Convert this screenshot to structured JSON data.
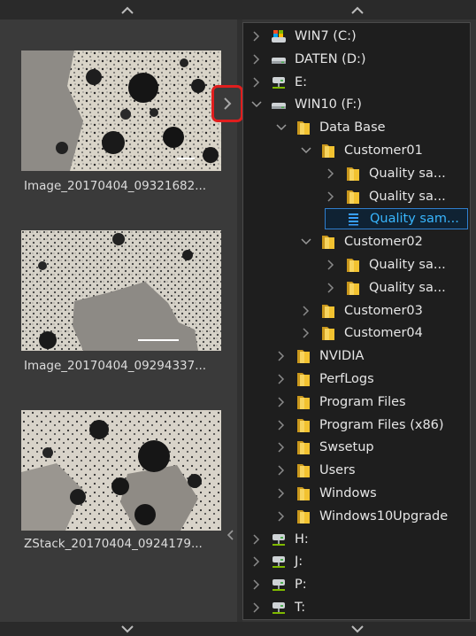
{
  "thumbnails": [
    {
      "name": "Image_20170404_09321682..."
    },
    {
      "name": "Image_20170404_09294337..."
    },
    {
      "name": "ZStack_20170404_0924179..."
    }
  ],
  "tree": {
    "items": [
      {
        "label": "WIN7 (C:)",
        "level": 0,
        "icon": "drive-windows-icon",
        "state": "collapsed"
      },
      {
        "label": "DATEN (D:)",
        "level": 0,
        "icon": "drive-icon",
        "state": "collapsed"
      },
      {
        "label": "E:",
        "level": 0,
        "icon": "drive-network-icon",
        "state": "collapsed"
      },
      {
        "label": "WIN10 (F:)",
        "level": 0,
        "icon": "drive-icon",
        "state": "expanded"
      },
      {
        "label": "Data Base",
        "level": 1,
        "icon": "folder-icon",
        "state": "expanded"
      },
      {
        "label": "Customer01",
        "level": 2,
        "icon": "folder-icon",
        "state": "expanded"
      },
      {
        "label": "Quality sa...",
        "level": 3,
        "icon": "folder-icon",
        "state": "collapsed"
      },
      {
        "label": "Quality sa...",
        "level": 3,
        "icon": "folder-icon",
        "state": "collapsed"
      },
      {
        "label": "Quality sam...",
        "level": 3,
        "icon": "database-file-icon",
        "state": "leaf",
        "selected": true
      },
      {
        "label": "Customer02",
        "level": 2,
        "icon": "folder-icon",
        "state": "expanded"
      },
      {
        "label": "Quality sa...",
        "level": 3,
        "icon": "folder-icon",
        "state": "collapsed"
      },
      {
        "label": "Quality sa...",
        "level": 3,
        "icon": "folder-icon",
        "state": "collapsed"
      },
      {
        "label": "Customer03",
        "level": 2,
        "icon": "folder-icon",
        "state": "collapsed"
      },
      {
        "label": "Customer04",
        "level": 2,
        "icon": "folder-icon",
        "state": "collapsed"
      },
      {
        "label": "NVIDIA",
        "level": 1,
        "icon": "folder-icon",
        "state": "collapsed"
      },
      {
        "label": "PerfLogs",
        "level": 1,
        "icon": "folder-icon",
        "state": "collapsed"
      },
      {
        "label": "Program Files",
        "level": 1,
        "icon": "folder-icon",
        "state": "collapsed"
      },
      {
        "label": "Program Files (x86)",
        "level": 1,
        "icon": "folder-icon",
        "state": "collapsed"
      },
      {
        "label": "Swsetup",
        "level": 1,
        "icon": "folder-icon",
        "state": "collapsed"
      },
      {
        "label": "Users",
        "level": 1,
        "icon": "folder-icon",
        "state": "collapsed"
      },
      {
        "label": "Windows",
        "level": 1,
        "icon": "folder-icon",
        "state": "collapsed"
      },
      {
        "label": "Windows10Upgrade",
        "level": 1,
        "icon": "folder-icon",
        "state": "collapsed"
      },
      {
        "label": "H:",
        "level": 0,
        "icon": "drive-network-icon",
        "state": "collapsed"
      },
      {
        "label": "J:",
        "level": 0,
        "icon": "drive-network-icon",
        "state": "collapsed"
      },
      {
        "label": "P:",
        "level": 0,
        "icon": "drive-network-icon",
        "state": "collapsed"
      },
      {
        "label": "T:",
        "level": 0,
        "icon": "drive-network-icon",
        "state": "collapsed"
      }
    ]
  },
  "colors": {
    "background": "#353535",
    "tree_background": "#1e1e1e",
    "selection_text": "#38b6ff",
    "folder": "#f2c230",
    "highlight_box": "#e01e1e"
  }
}
